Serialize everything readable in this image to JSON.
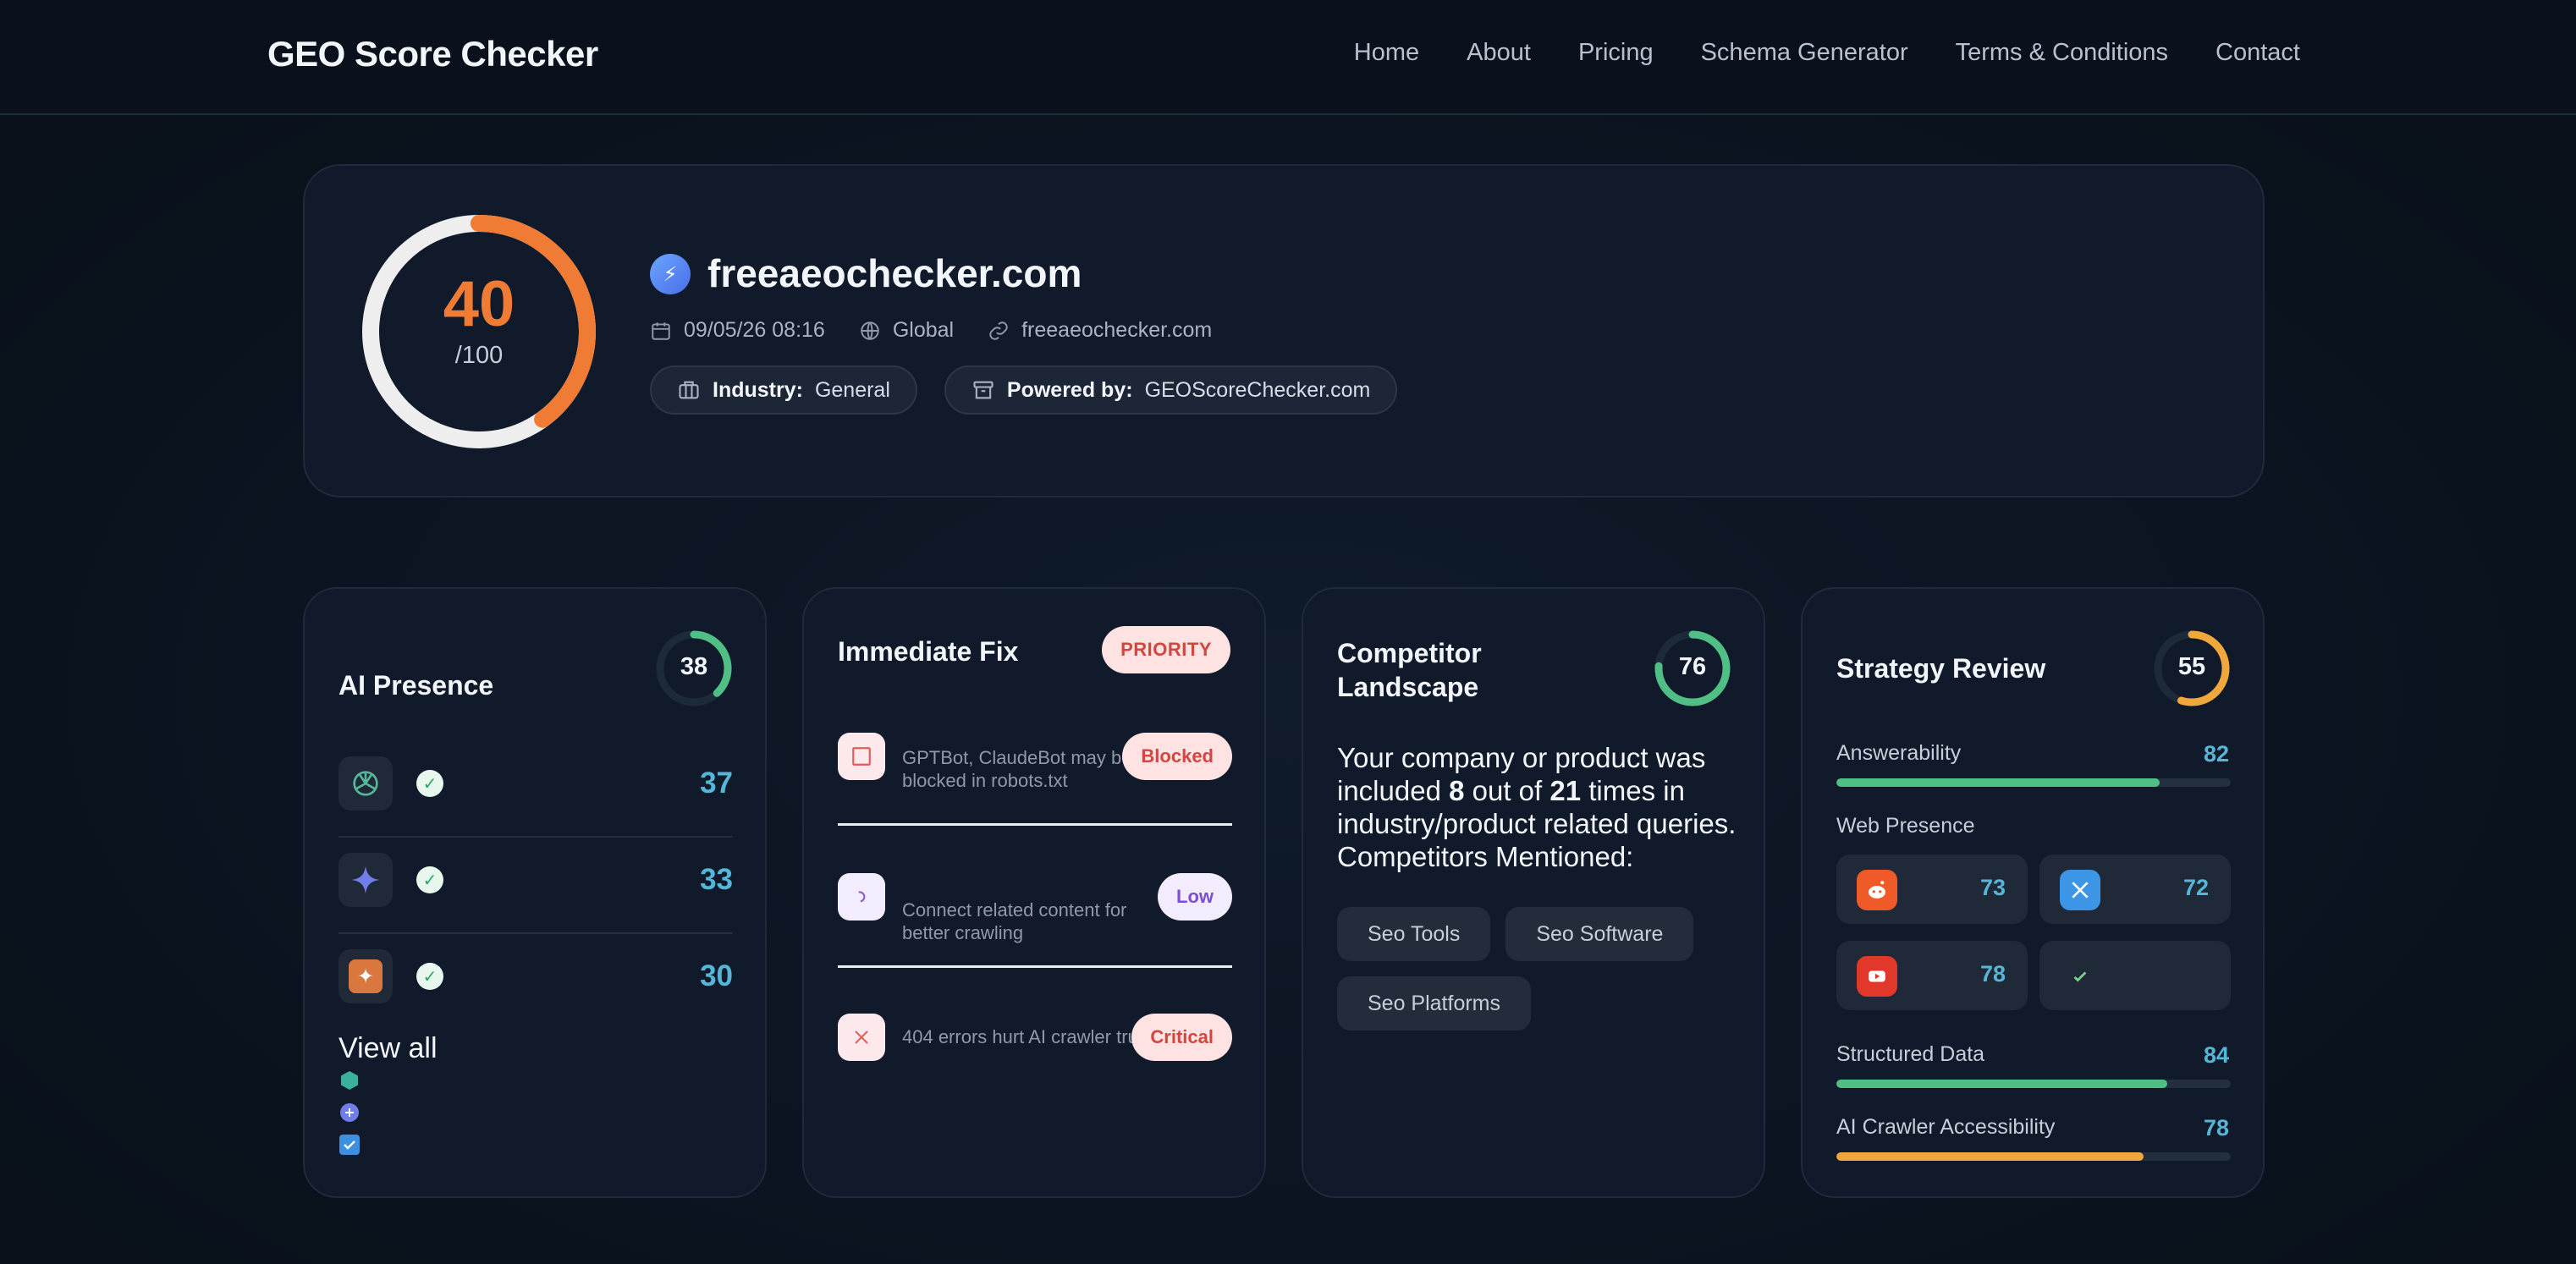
{
  "header": {
    "brand": "GEO Score Checker",
    "nav": [
      "Home",
      "About",
      "Pricing",
      "Schema Generator",
      "Terms & Conditions",
      "Contact"
    ]
  },
  "hero": {
    "score": "40",
    "score_total": "/100",
    "score_fraction": 0.4,
    "domain": "freeaeochecker.com",
    "date": "09/05/26 08:16",
    "region": "Global",
    "url": "freeaeochecker.com",
    "industry_label": "Industry:",
    "industry_value": "General",
    "powered_label": "Powered by:",
    "powered_value": "GEOScoreChecker.com",
    "score_color": "#ef7b35"
  },
  "ai_presence": {
    "title": "AI Presence",
    "score": "38",
    "score_fraction": 0.38,
    "ring_color": "#4fbf86",
    "rows": [
      {
        "icon": "openai-icon",
        "value": "37"
      },
      {
        "icon": "gemini-icon",
        "value": "33"
      },
      {
        "icon": "claude-icon",
        "value": "30"
      }
    ],
    "view_all": "View all"
  },
  "immediate_fix": {
    "title": "Immediate Fix",
    "priority": "PRIORITY",
    "items": [
      {
        "icon": "square-icon",
        "text": "GPTBot, ClaudeBot may be blocked in robots.txt",
        "badge": "Blocked"
      },
      {
        "icon": "link-icon",
        "text": "Connect related content for better crawling",
        "badge": "Low"
      },
      {
        "icon": "x-icon",
        "text": "404 errors hurt AI crawler trust",
        "badge": "Critical"
      }
    ]
  },
  "competitor": {
    "title_line1": "Competitor",
    "title_line2": "Landscape",
    "score": "76",
    "score_fraction": 0.76,
    "ring_color": "#4fbf86",
    "text_before": "Your company or product was included ",
    "mentions": "8",
    "text_middle": " out of ",
    "total": "21",
    "text_after": " times in industry/product related queries.",
    "competitors_label": "Competitors Mentioned:",
    "tags": [
      "Seo Tools",
      "Seo Software",
      "Seo Platforms"
    ]
  },
  "strategy": {
    "title": "Strategy Review",
    "score": "55",
    "score_fraction": 0.55,
    "ring_color": "#f0a83c",
    "answerability_label": "Answerability",
    "answerability": "82",
    "answerability_fraction": 0.82,
    "web_presence_label": "Web Presence",
    "web_presence": [
      {
        "icon": "reddit-icon",
        "value": "73"
      },
      {
        "icon": "x-twitter-icon",
        "value": "72"
      },
      {
        "icon": "youtube-icon",
        "value": "78"
      },
      {
        "icon": "check-icon",
        "value": ""
      }
    ],
    "structured_label": "Structured Data",
    "structured": "84",
    "structured_fraction": 0.84,
    "crawler_label": "AI Crawler Accessibility",
    "crawler": "78",
    "crawler_fraction": 0.78,
    "green": "#4fbf86",
    "orange": "#f0a83c"
  }
}
